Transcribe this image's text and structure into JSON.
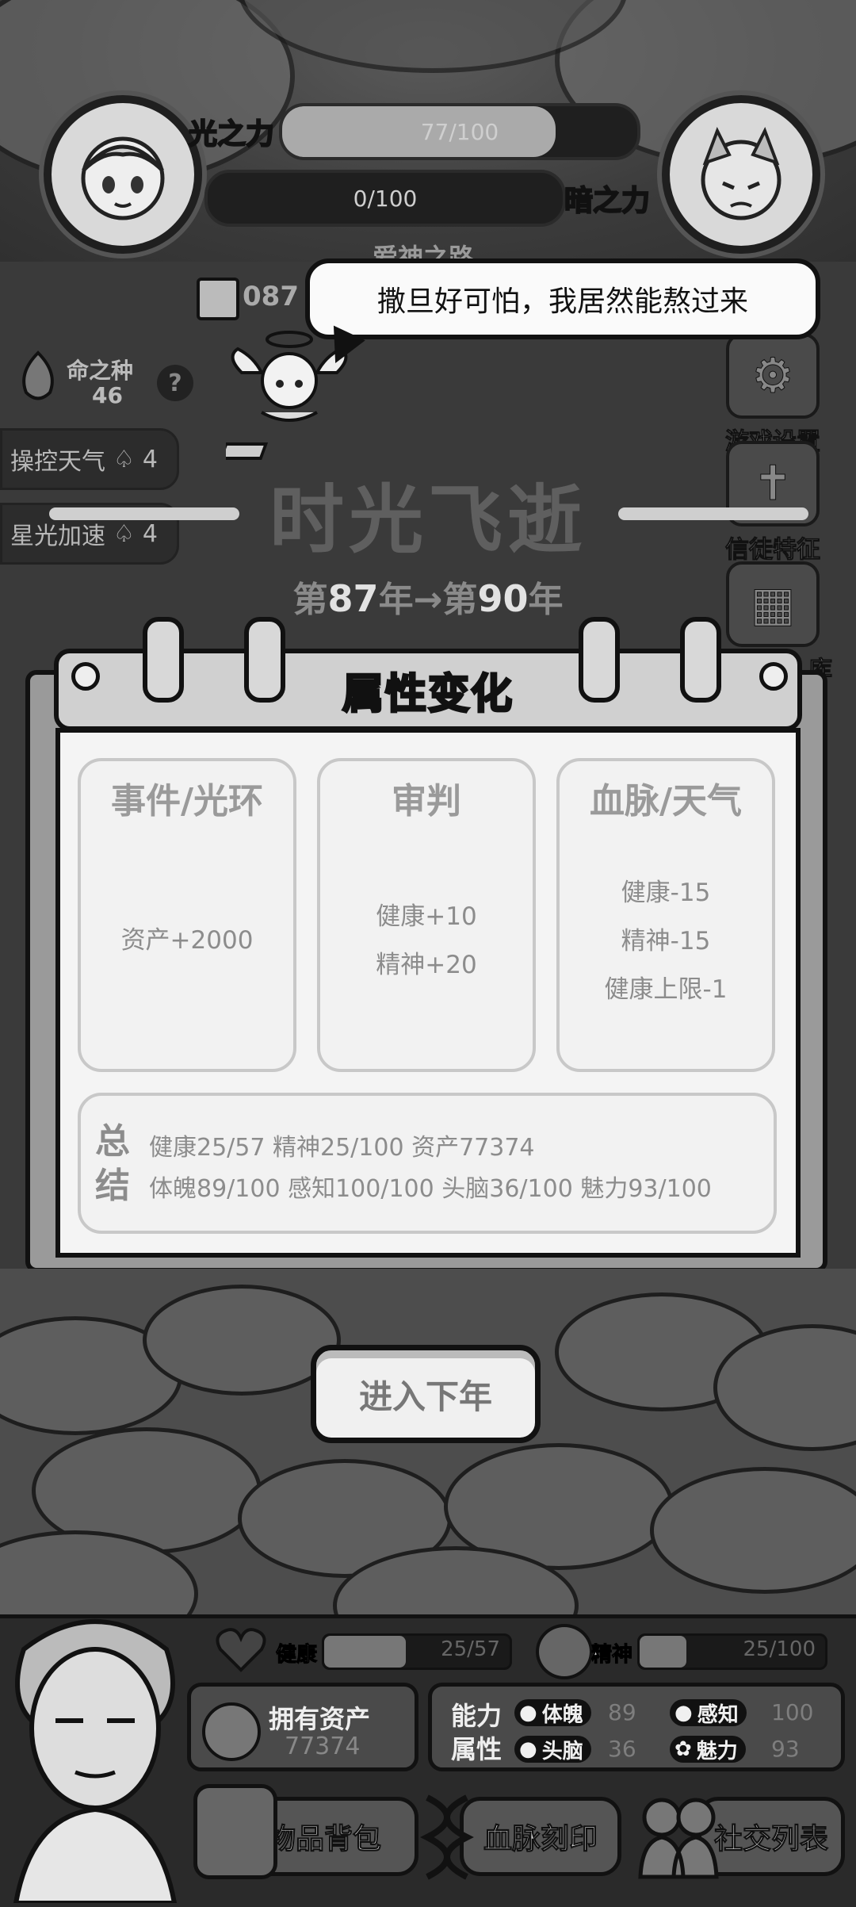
{
  "top": {
    "light_label": "光之力",
    "light_value": "77/100",
    "light_fraction": 0.77,
    "dark_label": "暗之力",
    "dark_value": "0/100",
    "dark_fraction": 0.0,
    "partial_label": "爱神之路",
    "date_partial": "087"
  },
  "left": {
    "seed_label": "命之种",
    "seed_count": "46",
    "help_icon": "question-icon",
    "skills": [
      {
        "label": "操控天气",
        "count": "4",
        "icon": "seed-icon"
      },
      {
        "label": "星光加速",
        "count": "4",
        "icon": "seed-icon"
      }
    ]
  },
  "right": {
    "settings": "游戏设置",
    "followers": "信徒特征",
    "cards_partial": "库"
  },
  "speech": "撒旦好可怕，我居然能熬过来",
  "heading": "时光飞逝",
  "years": {
    "prefix1": "第",
    "from": "87",
    "mid": "年→第",
    "to": "90",
    "suffix": "年"
  },
  "panel": {
    "title": "属性变化",
    "cards": [
      {
        "title": "事件/光环",
        "lines": [
          "资产+2000"
        ]
      },
      {
        "title": "审判",
        "lines": [
          "健康+10",
          "精神+20"
        ]
      },
      {
        "title": "血脉/天气",
        "lines": [
          "健康-15",
          "精神-15",
          "健康上限-1"
        ]
      }
    ],
    "summary_label": "总结",
    "summary_row1": "健康25/57  精神25/100  资产77374",
    "summary_row2": "体魄89/100  感知100/100  头脑36/100  魅力93/100"
  },
  "next_button": "进入下年",
  "hud": {
    "health_label": "健康",
    "health_value": "25/57",
    "health_fraction": 0.44,
    "spirit_label": "精神",
    "spirit_value": "25/100",
    "spirit_fraction": 0.25,
    "assets_label": "拥有资产",
    "assets_value": "77374",
    "ability_label1": "能力",
    "ability_label2": "属性",
    "stats": [
      {
        "label": "体魄",
        "value": "89"
      },
      {
        "label": "感知",
        "value": "100"
      },
      {
        "label": "头脑",
        "value": "36"
      },
      {
        "label": "魅力",
        "value": "93"
      }
    ],
    "buttons": [
      "物品背包",
      "血脉刻印",
      "社交列表"
    ]
  }
}
